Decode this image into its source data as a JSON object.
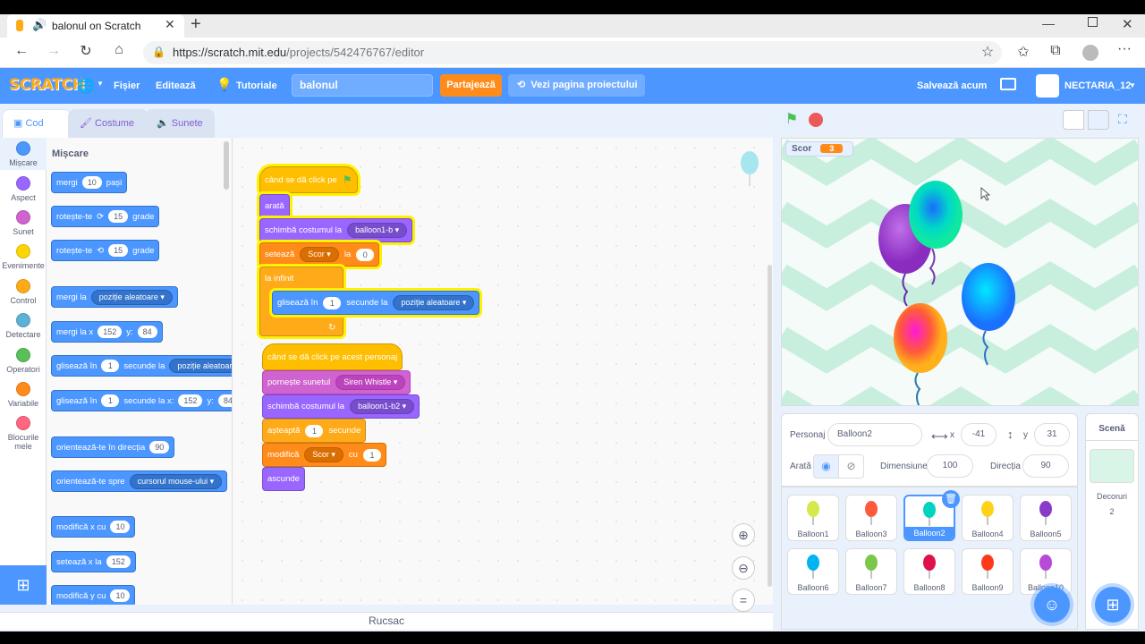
{
  "browser": {
    "tab_title": "balonul on Scratch",
    "url_main": "https://scratch.mit.edu",
    "url_path": "/projects/542476767/editor"
  },
  "menu": {
    "logo": "SCRATCH",
    "file": "Fișier",
    "edit": "Editează",
    "tutorials": "Tutoriale",
    "project_title": "balonul",
    "share": "Partajează",
    "see_project": "Vezi pagina proiectului",
    "save_now": "Salvează acum",
    "username": "NECTARIA_12"
  },
  "editor_tabs": [
    "Cod",
    "Costume",
    "Sunete"
  ],
  "categories": [
    {
      "label": "Mișcare",
      "color": "#4c97ff"
    },
    {
      "label": "Aspect",
      "color": "#9966ff"
    },
    {
      "label": "Sunet",
      "color": "#cf63cf"
    },
    {
      "label": "Evenimente",
      "color": "#ffd500"
    },
    {
      "label": "Control",
      "color": "#ffab19"
    },
    {
      "label": "Detectare",
      "color": "#5cb1d6"
    },
    {
      "label": "Operatori",
      "color": "#59c059"
    },
    {
      "label": "Variabile",
      "color": "#ff8c1a"
    },
    {
      "label": "Blocurile mele",
      "color": "#ff6680"
    }
  ],
  "palette": {
    "heading": "Mișcare",
    "b1": {
      "a": "mergi",
      "v": "10",
      "b": "pași"
    },
    "b2": {
      "a": "rotește-te",
      "v": "15",
      "b": "grade"
    },
    "b3": {
      "a": "rotește-te",
      "v": "15",
      "b": "grade"
    },
    "b4": {
      "a": "mergi la",
      "d": "poziție aleatoare"
    },
    "b5": {
      "a": "mergi la x",
      "x": "152",
      "y_label": "y:",
      "y": "84"
    },
    "b6": {
      "a": "glisează în",
      "v": "1",
      "b": "secunde la",
      "d": "poziție aleatoare"
    },
    "b7": {
      "a": "glisează în",
      "v": "1",
      "b": "secunde la x:",
      "x": "152",
      "y_label": "y:",
      "y": "84"
    },
    "b8": {
      "a": "orientează-te în direcția",
      "v": "90"
    },
    "b9": {
      "a": "orientează-te spre",
      "d": "cursorul mouse-ului"
    },
    "b10": {
      "a": "modifică x cu",
      "v": "10"
    },
    "b11": {
      "a": "setează x la",
      "v": "152"
    },
    "b12": {
      "a": "modifică y cu",
      "v": "10"
    }
  },
  "script1": {
    "hat": "când se dă click pe",
    "show": "arată",
    "costume": {
      "a": "schimbă costumul la",
      "d": "balloon1-b"
    },
    "set": {
      "a": "setează",
      "d": "Scor",
      "b": "la",
      "v": "0"
    },
    "forever": "la infinit",
    "glide": {
      "a": "glisează în",
      "v": "1",
      "b": "secunde la",
      "d": "poziție aleatoare"
    }
  },
  "script2": {
    "hat": "când se dă click pe acest personaj",
    "sound": {
      "a": "pornește sunetul",
      "d": "Siren Whistle"
    },
    "costume": {
      "a": "schimbă costumul la",
      "d": "balloon1-b2"
    },
    "wait": {
      "a": "așteaptă",
      "v": "1",
      "b": "secunde"
    },
    "change": {
      "a": "modifică",
      "d": "Scor",
      "b": "cu",
      "v": "1"
    },
    "hide": "ascunde"
  },
  "backpack": "Rucsac",
  "stage": {
    "monitor_label": "Scor",
    "monitor_value": "3"
  },
  "sprite_info": {
    "sprite_label": "Personaj",
    "sprite_name": "Balloon2",
    "x_label": "x",
    "x": "-41",
    "y_label": "y",
    "y": "31",
    "show_label": "Arată",
    "size_label": "Dimensiune",
    "size": "100",
    "direction_label": "Direcția",
    "direction": "90"
  },
  "sprites": [
    {
      "name": "Balloon1",
      "color": "#d6e84a"
    },
    {
      "name": "Balloon3",
      "color": "#ff5a3c"
    },
    {
      "name": "Balloon2",
      "color": "#00d4c0"
    },
    {
      "name": "Balloon4",
      "color": "#ffd21a"
    },
    {
      "name": "Balloon5",
      "color": "#8a3ac8"
    },
    {
      "name": "Balloon6",
      "color": "#00b4f0"
    },
    {
      "name": "Balloon7",
      "color": "#7ac84a"
    },
    {
      "name": "Balloon8",
      "color": "#e0104a"
    },
    {
      "name": "Balloon9",
      "color": "#ff3a1a"
    },
    {
      "name": "Balloon10",
      "color": "#b84ad8"
    }
  ],
  "stage_pane": {
    "label": "Scenă",
    "backdrops_label": "Decoruri",
    "backdrops_count": "2"
  }
}
